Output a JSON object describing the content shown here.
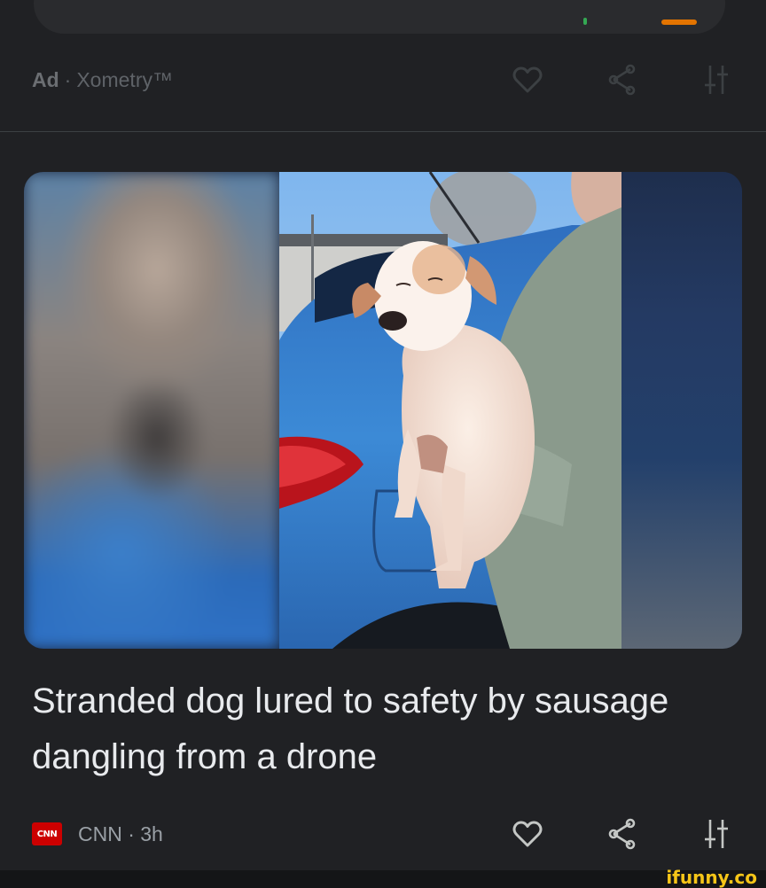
{
  "ad_row": {
    "badge": "Ad",
    "separator": "·",
    "advertiser": "Xometry™"
  },
  "article": {
    "headline": "Stranded dog lured to safety by sausage dangling from a drone",
    "source_logo": "CNN",
    "source_meta": "CNN · 3h"
  },
  "icons": {
    "like": "heart-outline-icon",
    "share": "share-icon",
    "tune": "sort-tune-icon"
  },
  "watermark": "ifunny.co",
  "colors": {
    "background": "#202124",
    "meta_text": "#9aa0a6",
    "cnn_red": "#cc0000",
    "watermark": "#f5c518"
  }
}
